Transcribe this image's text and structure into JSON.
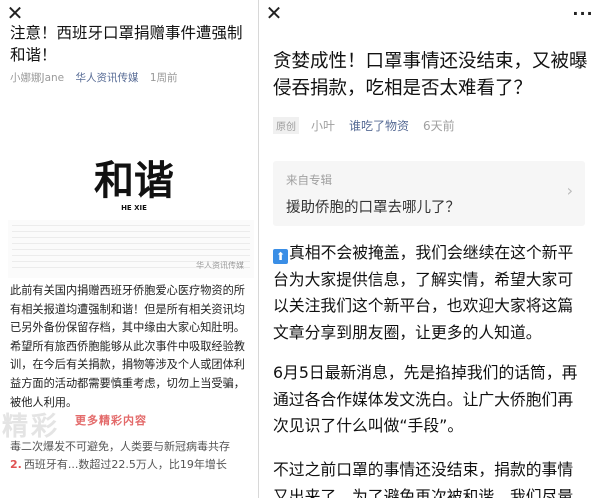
{
  "left": {
    "title": "注意！西班牙口罩捐赠事件遭强制和谐！",
    "author": "小娜娜Jane",
    "account": "华人资讯传媒",
    "time": "1周前",
    "logo_text": "和谐",
    "logo_sub": "HE XIE",
    "screenshot_watermark": "华人资讯传媒",
    "body": "此前有关国内捐赠西班牙侨胞爱心医疗物资的所有相关报道均遭强制和谐！但是所有相关资讯均已另外备份保留存档，其中缘由大家心知肚明。希望所有旅西侨胞能够从此次事件中吸取经验教训，在今后有关捐款，捐物等涉及个人或团体利益方面的活动都需要慎重考虑，切勿上当受骗，被他人利用。",
    "more_label": "更多精彩内容",
    "faded_line1": "毒二次爆发不可避免，人类要与新冠病毒共存",
    "faded_line2_num": "2.",
    "faded_line2": "西班牙有...数超过22.5万人，比19年增长",
    "watermark_text": "精彩"
  },
  "right": {
    "title": "贪婪成性！口罩事情还没结束，又被曝侵吞捐款，吃相是否太难看了？",
    "original_tag": "原创",
    "author": "小叶",
    "account": "谁吃了物资",
    "time": "6天前",
    "album_label": "来自专辑",
    "album_title": "援助侨胞的口罩去哪儿了？",
    "p1": "真相不会被掩盖，我们会继续在这个新平台为大家提供信息，了解实情，希望大家可以关注我们这个新平台，也欢迎大家将这篇文章分享到朋友圈，让更多的人知道。",
    "p2": "6月5日最新消息，先是掐掉我们的话筒，再通过各合作媒体发文洗白。让广大侨胞们再次见识了什么叫做“手段”。",
    "p3": "不过之前口罩的事情还没结束，捐款的事情又出来了，为了避免再次被和谐，我们尽量"
  },
  "icons": {
    "close": "close-icon",
    "more": "more-dots-icon",
    "chevron": "chevron-right-icon",
    "arrow": "up-arrow-icon"
  },
  "colors": {
    "link": "#576b95",
    "accent": "#3a8ee6",
    "more_label": "#e36a6a"
  }
}
